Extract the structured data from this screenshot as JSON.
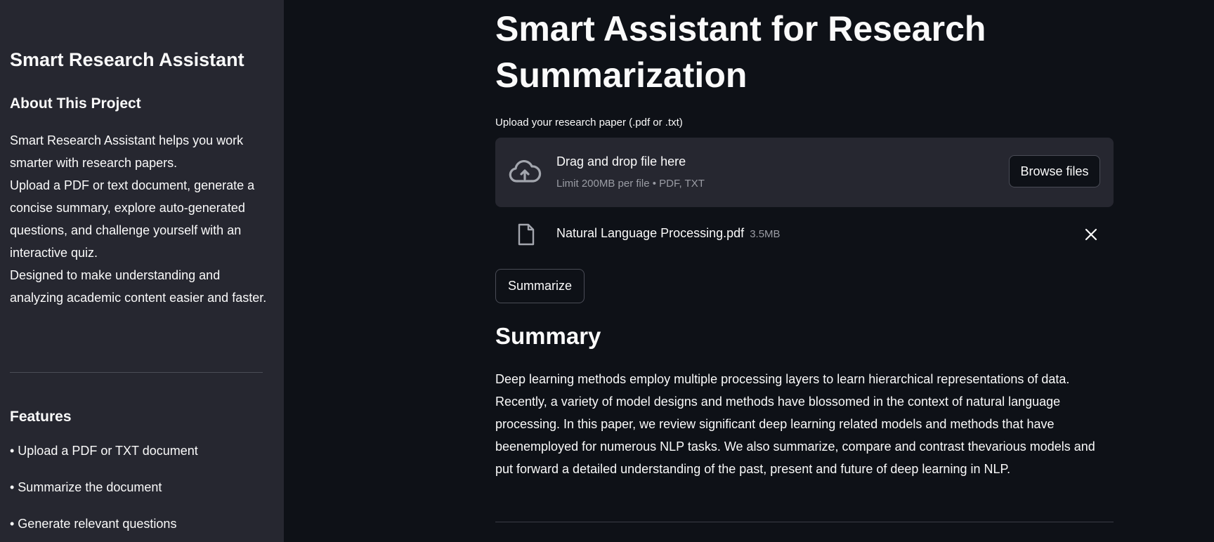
{
  "sidebar": {
    "title": "Smart Research Assistant",
    "about_heading": "About This Project",
    "about_paragraphs": [
      "Smart Research Assistant helps you work smarter with research papers.",
      "Upload a PDF or text document, generate a concise summary, explore auto-generated questions, and challenge yourself with an interactive quiz.",
      "Designed to make understanding and analyzing academic content easier and faster."
    ],
    "features_heading": "Features",
    "features": [
      "• Upload a PDF or TXT document",
      "• Summarize the document",
      "• Generate relevant questions"
    ]
  },
  "main": {
    "title": "Smart Assistant for Research Summarization",
    "upload_label": "Upload your research paper (.pdf or .txt)",
    "dropzone": {
      "icon": "cloud-upload-icon",
      "title": "Drag and drop file here",
      "limit": "Limit 200MB per file • PDF, TXT",
      "browse_label": "Browse files"
    },
    "file": {
      "icon": "file-icon",
      "name": "Natural Language Processing.pdf",
      "size": "3.5MB",
      "remove_icon": "close-icon"
    },
    "summarize_label": "Summarize",
    "summary_heading": "Summary",
    "summary_text": "Deep learning methods employ multiple processing layers to learn hierarchical representations of data. Recently, a variety of model designs and methods have blossomed in the context of natural language processing. In this paper, we review significant deep learning related models and methods that have beenemployed for numerous NLP tasks. We also summarize, compare and contrast thevarious models and put forward a detailed understanding of the past, present and future of deep learning in NLP."
  },
  "colors": {
    "background": "#0e1117",
    "sidebar": "#262730",
    "dropzone": "#262730",
    "text": "#fafafa",
    "muted_text": "#9a9ca4",
    "border": "#4a4c56"
  }
}
